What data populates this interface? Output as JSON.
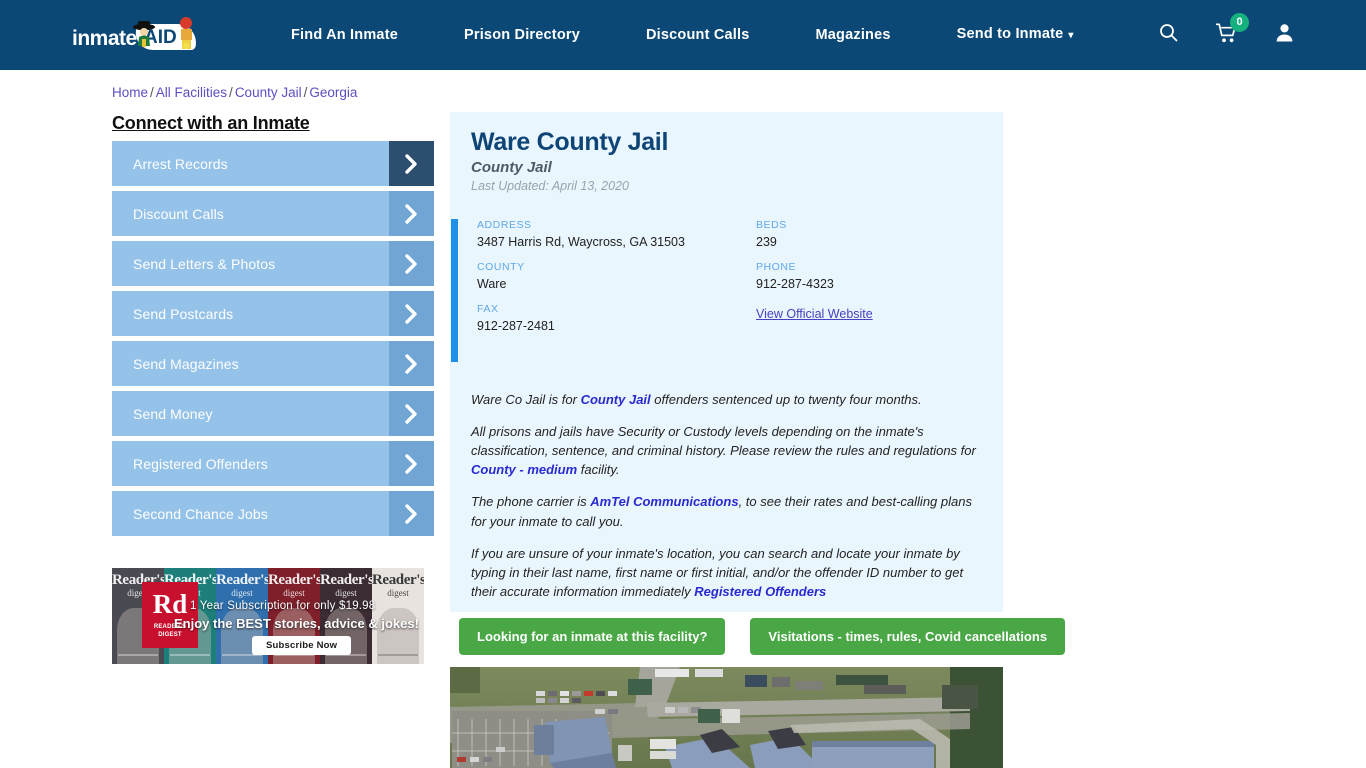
{
  "header": {
    "logo_text": "inmate",
    "logo_aid": "AID",
    "logo_name": "inmateAID",
    "nav": [
      {
        "label": "Find An Inmate",
        "name": "nav-find-an-inmate",
        "caret": ""
      },
      {
        "label": "Prison Directory",
        "name": "nav-prison-directory",
        "caret": ""
      },
      {
        "label": "Discount Calls",
        "name": "nav-discount-calls",
        "caret": ""
      },
      {
        "label": "Magazines",
        "name": "nav-magazines",
        "caret": ""
      },
      {
        "label": "Send to Inmate",
        "name": "nav-send-to-inmate",
        "caret": "▾"
      }
    ],
    "icons": {
      "search": "search-icon",
      "cart": "cart-icon",
      "cart_count": "0",
      "account": "user-icon"
    },
    "colors": {
      "bar": "#0b4875",
      "cart_badge": "#17b07f"
    }
  },
  "breadcrumb": {
    "items": [
      "Home",
      "All Facilities",
      "County Jail",
      "Georgia"
    ],
    "separator": "/"
  },
  "sidebar": {
    "title": "Connect with an Inmate",
    "items": [
      {
        "label": "Arrest Records"
      },
      {
        "label": "Discount Calls"
      },
      {
        "label": "Send Letters & Photos"
      },
      {
        "label": "Send Postcards"
      },
      {
        "label": "Send Magazines"
      },
      {
        "label": "Send Money"
      },
      {
        "label": "Registered Offenders"
      },
      {
        "label": "Second Chance Jobs"
      }
    ],
    "colors": {
      "button": "#95c2e8",
      "arrow": "#70a5d4",
      "arrow_active": "#2c4e6f"
    }
  },
  "ad": {
    "brand": "Rd",
    "brand_sub": "READER'S\nDIGEST",
    "brand_sub_1": "READER'S",
    "brand_sub_2": "DIGEST",
    "line1": "1 Year Subscription for only $19.98",
    "line2": "Enjoy the BEST stories, advice & jokes!",
    "cta": "Subscribe Now",
    "covers": [
      {
        "masthead": "Reader's",
        "sub": "digest"
      },
      {
        "masthead": "Reader's",
        "sub": "digest"
      },
      {
        "masthead": "Reader's",
        "sub": "digest"
      },
      {
        "masthead": "Reader's",
        "sub": "digest"
      },
      {
        "masthead": "Reader's",
        "sub": "digest"
      },
      {
        "masthead": "Reader's",
        "sub": "digest"
      }
    ]
  },
  "facility": {
    "name": "Ware County Jail",
    "type": "County Jail",
    "last_updated": "Last Updated: April 13, 2020",
    "info": [
      {
        "key": "ADDRESS",
        "value": "3487 Harris Rd, Waycross, GA 31503",
        "link": false
      },
      {
        "key": "BEDS",
        "value": "239",
        "link": false
      },
      {
        "key": "COUNTY",
        "value": "Ware",
        "link": false
      },
      {
        "key": "PHONE",
        "value": "912-287-4323",
        "link": false
      },
      {
        "key": "FAX",
        "value": "912-287-2481",
        "link": false
      },
      {
        "key": "",
        "value": "View Official Website",
        "link": true
      }
    ],
    "paragraphs": [
      {
        "parts": [
          {
            "t": "Ware Co Jail is for ",
            "link": false
          },
          {
            "t": "County Jail",
            "link": true
          },
          {
            "t": " offenders sentenced up to twenty four months.",
            "link": false
          }
        ]
      },
      {
        "parts": [
          {
            "t": "All prisons and jails have Security or Custody levels depending on the inmate's classification, sentence, and criminal history. Please review the rules and regulations for ",
            "link": false
          },
          {
            "t": "County - medium",
            "link": true
          },
          {
            "t": " facility.",
            "link": false
          }
        ]
      },
      {
        "parts": [
          {
            "t": "The phone carrier is ",
            "link": false
          },
          {
            "t": "AmTel Communications",
            "link": true
          },
          {
            "t": ", to see their rates and best-calling plans for your inmate to call you.",
            "link": false
          }
        ]
      },
      {
        "parts": [
          {
            "t": "If you are unsure of your inmate's location, you can search and locate your inmate by typing in their last name, first name or first initial, and/or the offender ID number to get their accurate information immediately ",
            "link": false
          },
          {
            "t": "Registered Offenders",
            "link": true
          }
        ]
      }
    ],
    "accent_color": "#1e90e8",
    "panel_color": "#eaf6fd"
  },
  "cta_buttons": [
    {
      "label": "Looking for an inmate at this facility?"
    },
    {
      "label": "Visitations - times, rules, Covid cancellations"
    }
  ],
  "aerial": {
    "alt": "aerial-satellite-view-of-facility"
  }
}
